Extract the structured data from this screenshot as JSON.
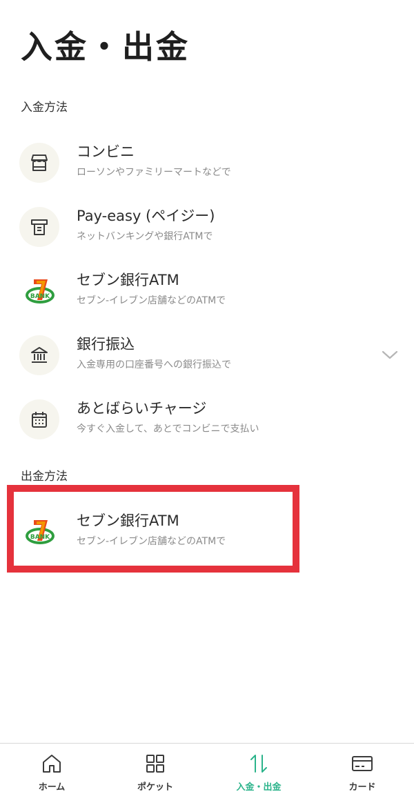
{
  "page_title": "入金・出金",
  "deposit": {
    "section_label": "入金方法",
    "items": [
      {
        "title": "コンビニ",
        "subtitle": "ローソンやファミリーマートなどで",
        "icon": "store-icon"
      },
      {
        "title": "Pay-easy (ペイジー)",
        "subtitle": "ネットバンキングや銀行ATMで",
        "icon": "atm-icon"
      },
      {
        "title": "セブン銀行ATM",
        "subtitle": "セブン-イレブン店舗などのATMで",
        "icon": "seven-bank-logo"
      },
      {
        "title": "銀行振込",
        "subtitle": "入金専用の口座番号への銀行振込で",
        "icon": "bank-icon"
      },
      {
        "title": "あとばらいチャージ",
        "subtitle": "今すぐ入金して、あとでコンビニで支払い",
        "icon": "calendar-icon"
      }
    ]
  },
  "withdraw": {
    "section_label": "出金方法",
    "items": [
      {
        "title": "セブン銀行ATM",
        "subtitle": "セブン-イレブン店舗などのATMで",
        "icon": "seven-bank-logo"
      }
    ]
  },
  "logo": {
    "text": "BANK",
    "number": "7"
  },
  "tabs": [
    {
      "label": "ホーム",
      "icon": "home-icon"
    },
    {
      "label": "ポケット",
      "icon": "grid-icon"
    },
    {
      "label": "入金・出金",
      "icon": "transfer-arrows-icon",
      "active": true
    },
    {
      "label": "カード",
      "icon": "card-icon"
    }
  ],
  "colors": {
    "accent": "#2ab38a",
    "highlight": "#e5323c",
    "icon_bg": "#f6f5ee"
  }
}
